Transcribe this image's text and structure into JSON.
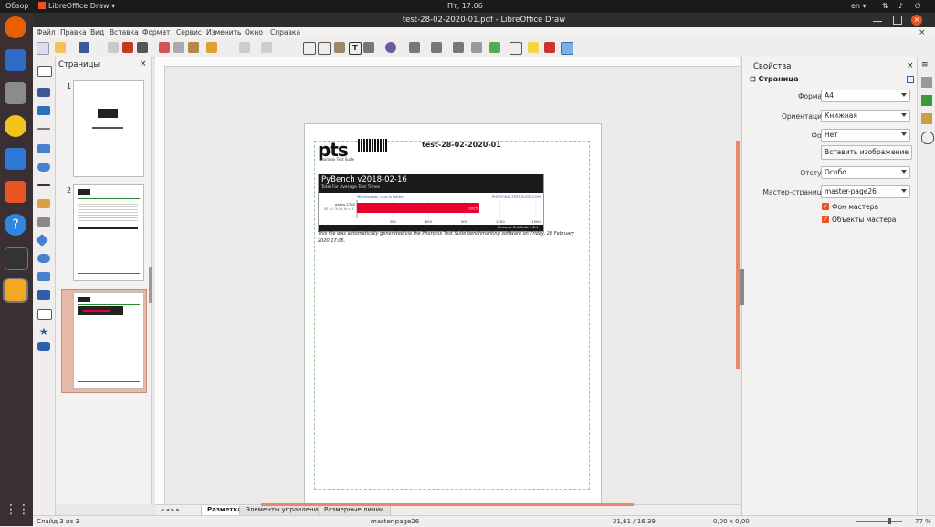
{
  "topbar": {
    "activities": "Обзор",
    "app": "LibreOffice Draw",
    "clock": "Пт, 17:06",
    "lang": "en"
  },
  "window": {
    "title": "test-28-02-2020-01.pdf - LibreOffice Draw"
  },
  "menu": [
    "Файл",
    "Правка",
    "Вид",
    "Вставка",
    "Формат",
    "Сервис",
    "Изменить",
    "Окно",
    "Справка"
  ],
  "pages_panel": {
    "title": "Страницы",
    "close": "×",
    "numbers": [
      "1",
      "2",
      "3"
    ]
  },
  "document": {
    "header_title": "test-28-02-2020-01",
    "logo": "pts",
    "logo_sub": "Phoronix Test Suite",
    "chart_title": "PyBench v2018-02-16",
    "chart_subtitle": "Total For Average Test Times",
    "legend": "Milliseconds, Less is Better",
    "watermark": "PHORONIX-TEST-SUITE.COM",
    "bar_label_1": "ozzen-2765",
    "bar_label_2": "SE +/- 3.00, N = 3",
    "bar_value": "1025",
    "footer_text": "Phoronix Test Suite 9.2.1",
    "note": "This file was automatically generated via the Phoronix Test Suite benchmarking software on Friday, 28 February 2020 17:05."
  },
  "chart_data": {
    "type": "bar",
    "categories": [
      "ozzen-2765"
    ],
    "values": [
      1025
    ],
    "title": "PyBench v2018-02-16",
    "subtitle": "Total For Average Test Times",
    "xlabel": "Milliseconds, Less is Better",
    "ticks": [
      "300",
      "600",
      "900",
      "1200",
      "1500"
    ],
    "xlim": [
      0,
      1500
    ]
  },
  "props": {
    "title": "Свойства",
    "section": "Страница",
    "format_label": "Формат:",
    "format_value": "A4",
    "orient_label": "Ориентация:",
    "orient_value": "Книжная",
    "bg_label": "Фон:",
    "bg_value": "Нет",
    "insert_image": "Вставить изображение",
    "margin_label": "Отступ:",
    "margin_value": "Особо",
    "master_label": "Мастер-страница:",
    "master_value": "master-page26",
    "chk_bg": "Фон мастера",
    "chk_obj": "Объекты мастера"
  },
  "tabs": [
    "Разметка",
    "Элементы управления",
    "Размерные линии"
  ],
  "status": {
    "slide": "Слайд 3 из 3",
    "master": "master-page26",
    "pos": "31,61 / 16,39",
    "size": "0,00 x 0,00",
    "zoom": "77 %"
  },
  "colors": {
    "accent": "#e95420",
    "bar": "#e7002e",
    "dark": "#1a1a1a"
  }
}
